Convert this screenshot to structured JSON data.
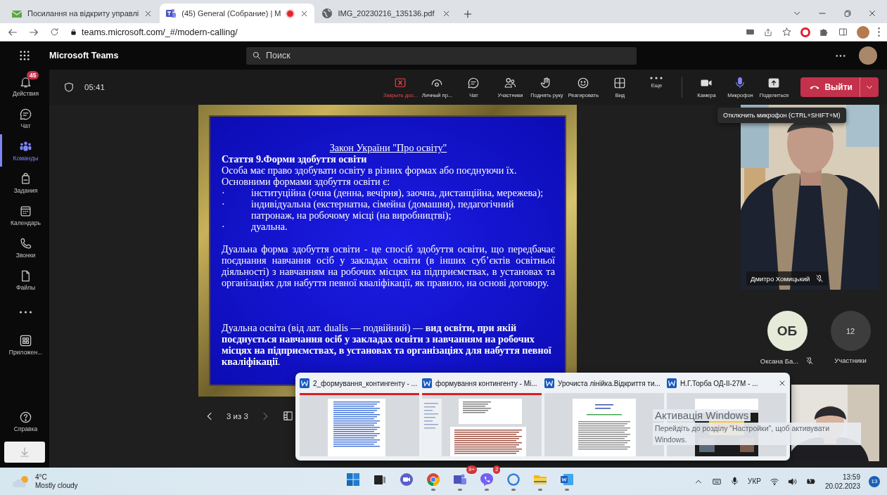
{
  "browser": {
    "tabs": [
      {
        "title": "Посилання на відкриту управлі",
        "selected": false,
        "recording": false
      },
      {
        "title": "(45) General (Собрание) | M",
        "selected": true,
        "recording": true
      },
      {
        "title": "IMG_20230216_135136.pdf",
        "selected": false,
        "recording": false
      }
    ],
    "address": "teams.microsoft.com/_#/modern-calling/"
  },
  "teams_header": {
    "title": "Microsoft Teams",
    "search": {
      "placeholder": "Поиск"
    }
  },
  "rail": {
    "items": [
      {
        "label": "Действия",
        "badge": "45",
        "selected": false
      },
      {
        "label": "Чат",
        "selected": false
      },
      {
        "label": "Команды",
        "selected": true
      },
      {
        "label": "Задания",
        "selected": false
      },
      {
        "label": "Календарь",
        "selected": false
      },
      {
        "label": "Звонки",
        "selected": false
      },
      {
        "label": "Файлы",
        "selected": false
      },
      {
        "selected": false
      },
      {
        "label": "Приложен...",
        "selected": false
      }
    ],
    "bottom": [
      {
        "label": "Справка"
      }
    ]
  },
  "meeting": {
    "timer": "05:41",
    "actions": [
      {
        "label": "Закрыть дос...",
        "kind": "danger"
      },
      {
        "label": "Личный пр...",
        "kind": "normal"
      },
      {
        "label": "Чат",
        "kind": "normal"
      },
      {
        "label": "Участники",
        "kind": "normal"
      },
      {
        "label": "Поднять руку",
        "kind": "normal"
      },
      {
        "label": "Реагировать",
        "kind": "normal"
      },
      {
        "label": "Вид",
        "kind": "normal"
      },
      {
        "label": "Еще",
        "kind": "normal"
      }
    ],
    "devices": [
      {
        "label": "Камера",
        "on": false
      },
      {
        "label": "Микрофон",
        "on": true
      },
      {
        "label": "Поделиться",
        "on": false
      }
    ],
    "leave": "Выйти"
  },
  "slide": {
    "title": "Закон України \"Про освіту\"",
    "heading": "Стаття 9.Форми здобуття освіти",
    "lines": [
      "Особа має право здобувати освіту в різних формах або поєднуючи їх.",
      "Основними формами здобуття освіти є:"
    ],
    "bullets": [
      {
        "mark": "·",
        "text": "інституційна (очна (денна, вечірня), заочна, дистанційна, мережева);"
      },
      {
        "mark": "·",
        "text": "індивідуальна (екстернатна, сімейна (домашня), педагогічний патронаж, на робочому місці (на виробництві);"
      },
      {
        "mark": "·",
        "text": "дуальна."
      }
    ],
    "paragraph": "Дуальна форма здобуття освіти - це спосіб здобуття освіти, що передбачає поєднання навчання осіб у закладах освіти (в інших суб’єктів освітньої діяльності) з навчанням на робочих місцях на підприємствах, в установах та організаціях для набуття певної кваліфікації, як правило, на основі договору.",
    "note": "Дуальна освіта (від лат. dualis — подвійний) — **вид освіти, при якій поєднується навчання осіб у закладах освіти з навчанням на робочих місцях на підприємствах, в установах та організаціях для набуття певної кваліфікації**."
  },
  "slide_nav": {
    "counter": "3 из 3"
  },
  "tooltip": "Отключить микрофон (CTRL+SHIFT+M)",
  "participants": {
    "video": {
      "name": "Дмитро Хомицький",
      "muted": true
    },
    "avatars": [
      {
        "initials": "ОБ",
        "name": "Оксана Ба...",
        "muted": true
      }
    ],
    "overflow": {
      "count": "12",
      "label": "Участники"
    }
  },
  "taskbar_popup": {
    "windows": [
      {
        "title": "2_формування_контингенту - ..."
      },
      {
        "title": "формування контингенту - Мі..."
      },
      {
        "title": "Урочиста лінійка.Відкриття ти..."
      },
      {
        "title": "Н.Г.Торба ОД-ІІ-27М - ..."
      }
    ]
  },
  "windows_activation": {
    "title": "Активація Windows",
    "text": "Перейдіть до розділу \"Настройки\", щоб активувати Windows."
  },
  "taskbar": {
    "weather": {
      "temp": "4°C",
      "text": "Mostly cloudy"
    },
    "apps": [
      {
        "running": false
      },
      {
        "running": false
      },
      {
        "running": false
      },
      {
        "running": true
      },
      {
        "badge": "9+",
        "running": true
      },
      {
        "badge": "2",
        "running": true
      },
      {
        "running": true
      },
      {
        "running": true
      },
      {
        "running": true
      }
    ],
    "language": "УКР",
    "time": "13:59",
    "date": "20.02.2023",
    "notifications": "13"
  }
}
